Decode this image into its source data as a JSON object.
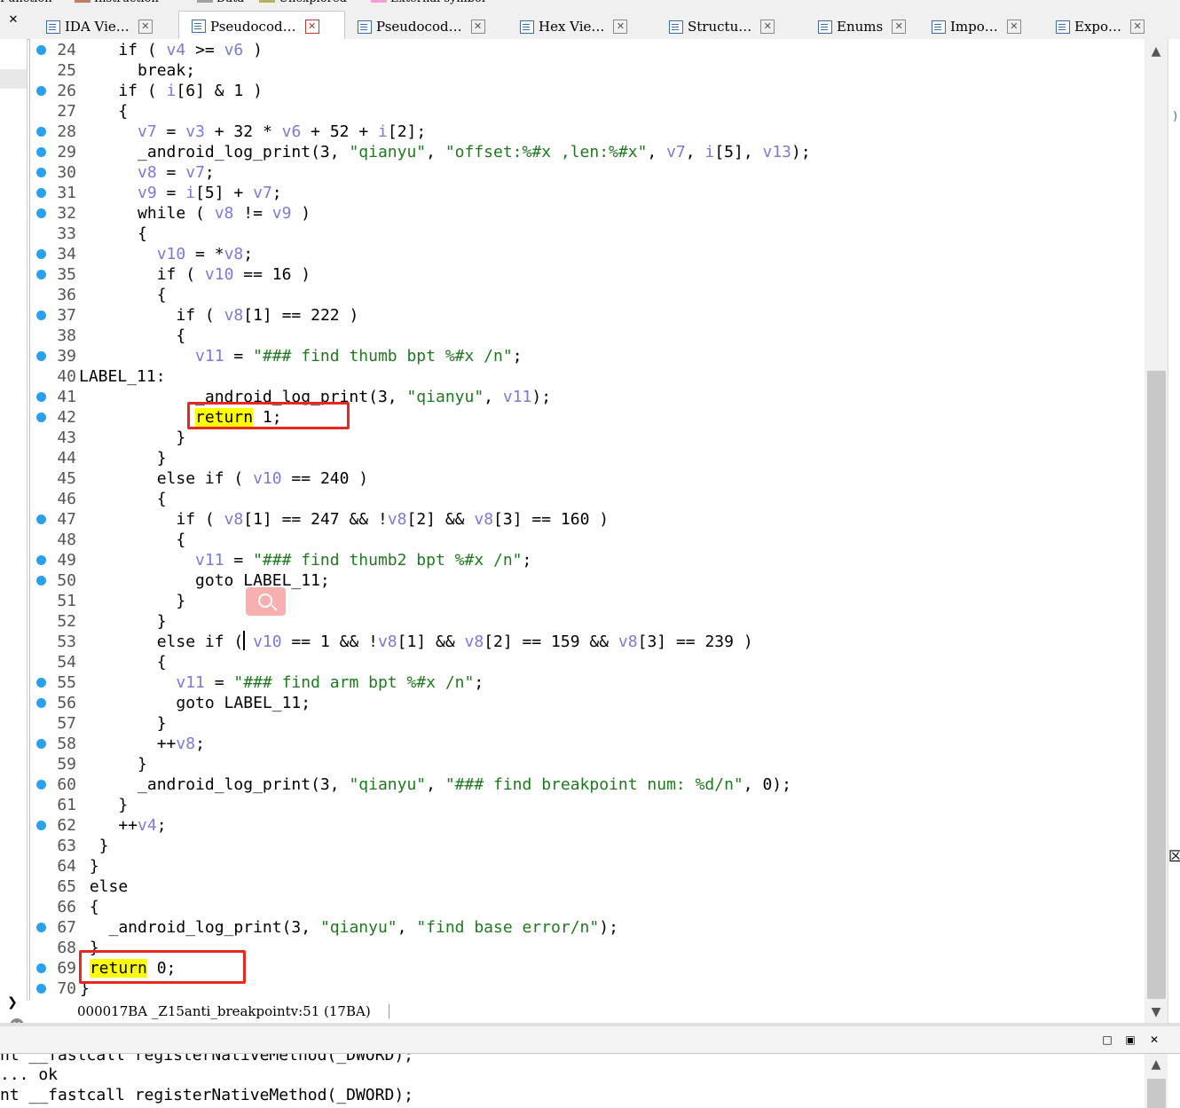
{
  "legend": [
    {
      "label": "Function",
      "color": "#f0f0f0"
    },
    {
      "label": "Instruction",
      "color": "#c08060"
    },
    {
      "label": "Data",
      "color": "#a0a0a0"
    },
    {
      "label": "Unexplored",
      "color": "#b8b060"
    },
    {
      "label": "External symbol",
      "color": "#ff9cd8"
    }
  ],
  "left_close": "✕",
  "tabs": [
    {
      "label": "IDA Vie…",
      "close": "✕",
      "active": false
    },
    {
      "label": "Pseudocod…",
      "close": "✕",
      "active": true
    },
    {
      "label": "Pseudocod…",
      "close": "✕",
      "active": false
    },
    {
      "label": "Hex Vie…",
      "close": "✕",
      "active": false
    },
    {
      "label": "Structu…",
      "close": "✕",
      "active": false
    },
    {
      "label": "Enums",
      "close": "✕",
      "active": false
    },
    {
      "label": "Impo…",
      "close": "✕",
      "active": false
    },
    {
      "label": "Expo…",
      "close": "✕",
      "active": false
    }
  ],
  "code_lines": [
    {
      "n": "24",
      "dot": true,
      "html": "    if ( <span class=\"v\">v4</span> >= <span class=\"v\">v6</span> )"
    },
    {
      "n": "25",
      "dot": false,
      "html": "      break;"
    },
    {
      "n": "26",
      "dot": true,
      "html": "    if ( <span class=\"v\">i</span>[6] & 1 )"
    },
    {
      "n": "27",
      "dot": false,
      "html": "    {"
    },
    {
      "n": "28",
      "dot": true,
      "html": "      <span class=\"v\">v7</span> = <span class=\"v\">v3</span> + 32 * <span class=\"v\">v6</span> + 52 + <span class=\"v\">i</span>[2];"
    },
    {
      "n": "29",
      "dot": true,
      "html": "      _android_log_print(3, <span class=\"s\">\"qianyu\"</span>, <span class=\"s\">\"offset:%#x ,len:%#x\"</span>, <span class=\"v\">v7</span>, <span class=\"v\">i</span>[5], <span class=\"v\">v13</span>);"
    },
    {
      "n": "30",
      "dot": true,
      "html": "      <span class=\"v\">v8</span> = <span class=\"v\">v7</span>;"
    },
    {
      "n": "31",
      "dot": true,
      "html": "      <span class=\"v\">v9</span> = <span class=\"v\">i</span>[5] + <span class=\"v\">v7</span>;"
    },
    {
      "n": "32",
      "dot": true,
      "html": "      while ( <span class=\"v\">v8</span> != <span class=\"v\">v9</span> )"
    },
    {
      "n": "33",
      "dot": false,
      "html": "      {"
    },
    {
      "n": "34",
      "dot": true,
      "html": "        <span class=\"v\">v10</span> = *<span class=\"v\">v8</span>;"
    },
    {
      "n": "35",
      "dot": true,
      "html": "        if ( <span class=\"v\">v10</span> == 16 )"
    },
    {
      "n": "36",
      "dot": false,
      "html": "        {"
    },
    {
      "n": "37",
      "dot": true,
      "html": "          if ( <span class=\"v\">v8</span>[1] == 222 )"
    },
    {
      "n": "38",
      "dot": false,
      "html": "          {"
    },
    {
      "n": "39",
      "dot": true,
      "html": "            <span class=\"v\">v11</span> = <span class=\"s\">\"### find thumb bpt %#x /n\"</span>;"
    },
    {
      "n": "40",
      "dot": false,
      "label": true,
      "html": "LABEL_11:"
    },
    {
      "n": "41",
      "dot": true,
      "html": "            _android_log_print(3, <span class=\"s\">\"qianyu\"</span>, <span class=\"v\">v11</span>);"
    },
    {
      "n": "42",
      "dot": true,
      "html": "            <span class=\"hl\">return</span> 1;"
    },
    {
      "n": "43",
      "dot": false,
      "html": "          }"
    },
    {
      "n": "44",
      "dot": false,
      "html": "        }"
    },
    {
      "n": "45",
      "dot": false,
      "html": "        else if ( <span class=\"v\">v10</span> == 240 )"
    },
    {
      "n": "46",
      "dot": false,
      "html": "        {"
    },
    {
      "n": "47",
      "dot": true,
      "html": "          if ( <span class=\"v\">v8</span>[1] == 247 && !<span class=\"v\">v8</span>[2] && <span class=\"v\">v8</span>[3] == 160 )"
    },
    {
      "n": "48",
      "dot": false,
      "html": "          {"
    },
    {
      "n": "49",
      "dot": true,
      "html": "            <span class=\"v\">v11</span> = <span class=\"s\">\"### find thumb2 bpt %#x /n\"</span>;"
    },
    {
      "n": "50",
      "dot": true,
      "html": "            goto LABEL_11;"
    },
    {
      "n": "51",
      "dot": false,
      "html": "          }"
    },
    {
      "n": "52",
      "dot": false,
      "html": "        }"
    },
    {
      "n": "53",
      "dot": false,
      "html": "        else if ( <span class=\"v\">v10</span> == 1 && !<span class=\"v\">v8</span>[1] && <span class=\"v\">v8</span>[2] == 159 && <span class=\"v\">v8</span>[3] == 239 )"
    },
    {
      "n": "54",
      "dot": false,
      "html": "        {"
    },
    {
      "n": "55",
      "dot": true,
      "html": "          <span class=\"v\">v11</span> = <span class=\"s\">\"### find arm bpt %#x /n\"</span>;"
    },
    {
      "n": "56",
      "dot": true,
      "html": "          goto LABEL_11;"
    },
    {
      "n": "57",
      "dot": false,
      "html": "        }"
    },
    {
      "n": "58",
      "dot": true,
      "html": "        ++<span class=\"v\">v8</span>;"
    },
    {
      "n": "59",
      "dot": false,
      "html": "      }"
    },
    {
      "n": "60",
      "dot": true,
      "html": "      _android_log_print(3, <span class=\"s\">\"qianyu\"</span>, <span class=\"s\">\"### find breakpoint num: %d/n\"</span>, 0);"
    },
    {
      "n": "61",
      "dot": false,
      "html": "    }"
    },
    {
      "n": "62",
      "dot": true,
      "html": "    ++<span class=\"v\">v4</span>;"
    },
    {
      "n": "63",
      "dot": false,
      "html": "  }"
    },
    {
      "n": "64",
      "dot": false,
      "html": " }"
    },
    {
      "n": "65",
      "dot": false,
      "html": " else"
    },
    {
      "n": "66",
      "dot": false,
      "html": " {"
    },
    {
      "n": "67",
      "dot": true,
      "html": "   _android_log_print(3, <span class=\"s\">\"qianyu\"</span>, <span class=\"s\">\"find base error/n\"</span>);"
    },
    {
      "n": "68",
      "dot": false,
      "html": " }"
    },
    {
      "n": "69",
      "dot": true,
      "html": " <span class=\"hl\">return</span> 0;"
    },
    {
      "n": "70",
      "dot": true,
      "html": "}"
    }
  ],
  "status": {
    "address": "000017BA",
    "location": "_Z15anti_breakpointv:51 (17BA)"
  },
  "scroll": {
    "up": "▲",
    "down": "▼"
  },
  "left": {
    "expand": "❯",
    "cancel": "✕"
  },
  "output_window": {
    "buttons": {
      "maximize": "□",
      "float": "▣",
      "close": "✕"
    },
    "lines": [
      "nt __fastcall registerNativeMethod(_DWORD);",
      "... ok",
      "nt __fastcall registerNativeMethod(_DWORD);"
    ]
  },
  "right_edge": {
    "mark_top": ")",
    "mark_mid": "区"
  },
  "colors": {
    "breakpoint_dot": "#2aa0f0",
    "variable": "#7a7ad8",
    "string": "#1f7a1f",
    "highlight": "#ffff00",
    "annotation_box": "#e8281e"
  }
}
